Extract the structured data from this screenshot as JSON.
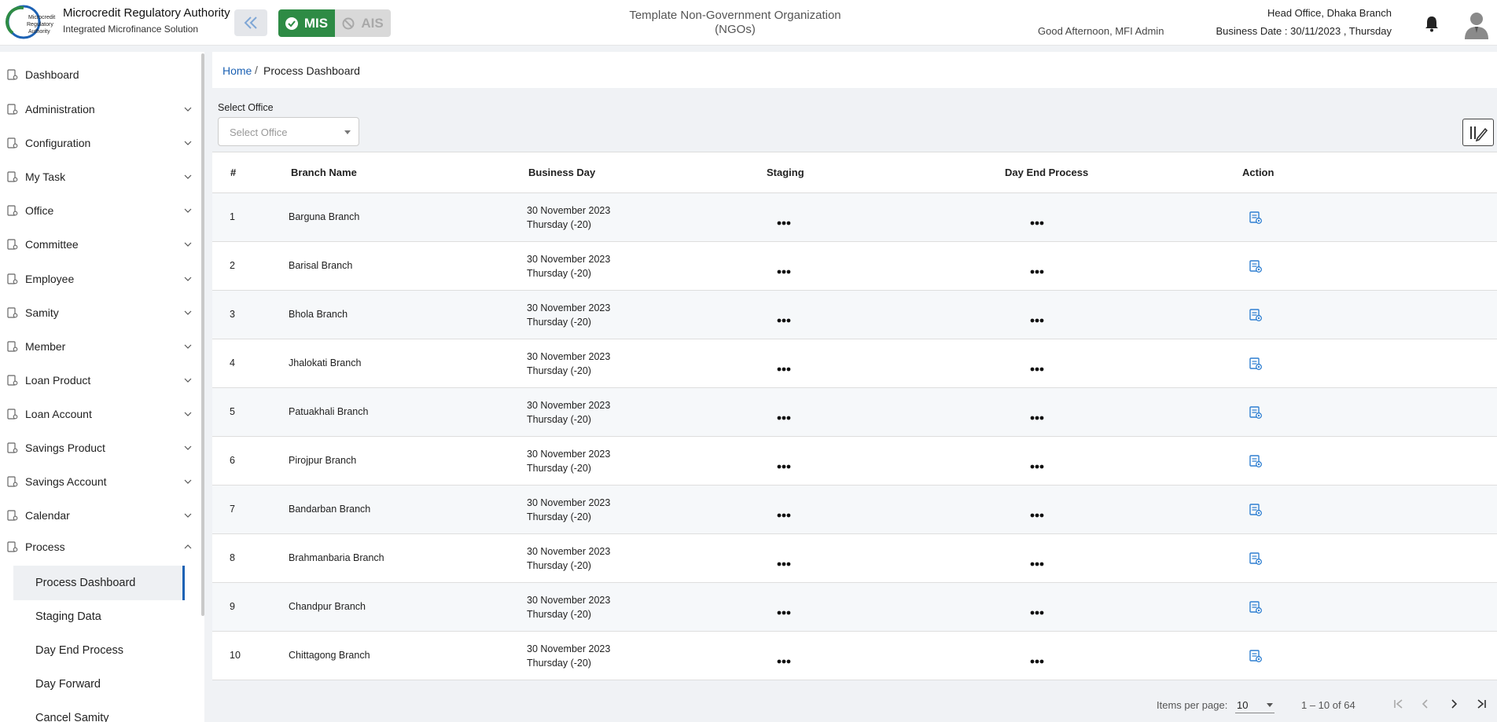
{
  "header": {
    "org_title": "Microcredit Regulatory Authority",
    "org_subtitle": "Integrated Microfinance Solution",
    "logo_text": [
      "Microcredit",
      "Regulatory",
      "Authority"
    ],
    "mis_label": "MIS",
    "ais_label": "AIS",
    "template_name": "Template Non-Government Organization (NGOs)",
    "greeting": "Good Afternoon, MFI Admin",
    "office": "Head Office, Dhaka Branch",
    "business_date": "Business Date : 30/11/2023 , Thursday",
    "colors": {
      "mis": "#2e8b45",
      "accent": "#1d62b4"
    }
  },
  "sidebar": {
    "items": [
      {
        "label": "Dashboard",
        "icon": "dashboard-icon",
        "has_chevron": false
      },
      {
        "label": "Administration",
        "icon": "admin-icon",
        "has_chevron": true
      },
      {
        "label": "Configuration",
        "icon": "config-icon",
        "has_chevron": true
      },
      {
        "label": "My Task",
        "icon": "task-icon",
        "has_chevron": true
      },
      {
        "label": "Office",
        "icon": "office-icon",
        "has_chevron": true
      },
      {
        "label": "Committee",
        "icon": "committee-icon",
        "has_chevron": true
      },
      {
        "label": "Employee",
        "icon": "employee-icon",
        "has_chevron": true
      },
      {
        "label": "Samity",
        "icon": "samity-icon",
        "has_chevron": true
      },
      {
        "label": "Member",
        "icon": "member-icon",
        "has_chevron": true
      },
      {
        "label": "Loan Product",
        "icon": "loan-product-icon",
        "has_chevron": true
      },
      {
        "label": "Loan Account",
        "icon": "loan-account-icon",
        "has_chevron": true
      },
      {
        "label": "Savings Product",
        "icon": "savings-product-icon",
        "has_chevron": true
      },
      {
        "label": "Savings Account",
        "icon": "savings-account-icon",
        "has_chevron": true
      },
      {
        "label": "Calendar",
        "icon": "calendar-icon",
        "has_chevron": true
      },
      {
        "label": "Process",
        "icon": "process-icon",
        "has_chevron": true,
        "expanded": true
      }
    ],
    "sub_items": [
      {
        "label": "Process Dashboard",
        "active": true
      },
      {
        "label": "Staging Data",
        "active": false
      },
      {
        "label": "Day End Process",
        "active": false
      },
      {
        "label": "Day Forward",
        "active": false
      },
      {
        "label": "Cancel Samity",
        "active": false
      }
    ]
  },
  "breadcrumb": {
    "home": "Home",
    "separator": "/",
    "current": "Process Dashboard"
  },
  "filter": {
    "label": "Select Office",
    "placeholder": "Select Office"
  },
  "table": {
    "headers": [
      "#",
      "Branch Name",
      "Business Day",
      "Staging",
      "Day End Process",
      "Action"
    ],
    "rows": [
      {
        "num": "1",
        "branch": "Barguna Branch",
        "day1": "30 November 2023",
        "day2": "Thursday (-20)"
      },
      {
        "num": "2",
        "branch": "Barisal Branch",
        "day1": "30 November 2023",
        "day2": "Thursday (-20)"
      },
      {
        "num": "3",
        "branch": "Bhola Branch",
        "day1": "30 November 2023",
        "day2": "Thursday (-20)"
      },
      {
        "num": "4",
        "branch": "Jhalokati Branch",
        "day1": "30 November 2023",
        "day2": "Thursday (-20)"
      },
      {
        "num": "5",
        "branch": "Patuakhali Branch",
        "day1": "30 November 2023",
        "day2": "Thursday (-20)"
      },
      {
        "num": "6",
        "branch": "Pirojpur Branch",
        "day1": "30 November 2023",
        "day2": "Thursday (-20)"
      },
      {
        "num": "7",
        "branch": "Bandarban Branch",
        "day1": "30 November 2023",
        "day2": "Thursday (-20)"
      },
      {
        "num": "8",
        "branch": "Brahmanbaria Branch",
        "day1": "30 November 2023",
        "day2": "Thursday (-20)"
      },
      {
        "num": "9",
        "branch": "Chandpur Branch",
        "day1": "30 November 2023",
        "day2": "Thursday (-20)"
      },
      {
        "num": "10",
        "branch": "Chittagong Branch",
        "day1": "30 November 2023",
        "day2": "Thursday (-20)"
      }
    ]
  },
  "pagination": {
    "items_per_page_label": "Items per page:",
    "items_per_page": "10",
    "range": "1 – 10 of 64"
  }
}
